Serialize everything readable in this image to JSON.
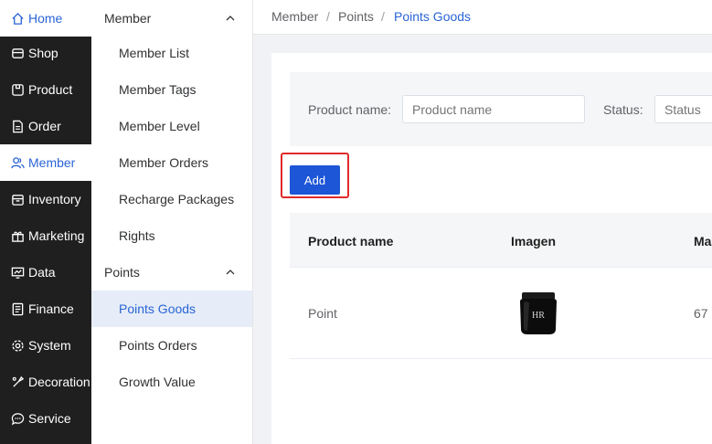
{
  "nav": {
    "items": [
      {
        "label": "Home",
        "icon": "home-icon"
      },
      {
        "label": "Shop",
        "icon": "shop-icon"
      },
      {
        "label": "Product",
        "icon": "product-icon"
      },
      {
        "label": "Order",
        "icon": "order-icon"
      },
      {
        "label": "Member",
        "icon": "member-icon"
      },
      {
        "label": "Inventory",
        "icon": "inventory-icon"
      },
      {
        "label": "Marketing",
        "icon": "gift-icon"
      },
      {
        "label": "Data",
        "icon": "chart-icon"
      },
      {
        "label": "Finance",
        "icon": "finance-icon"
      },
      {
        "label": "System",
        "icon": "gear-icon"
      },
      {
        "label": "Decoration",
        "icon": "decoration-icon"
      },
      {
        "label": "Service",
        "icon": "chat-icon"
      }
    ]
  },
  "submenu": {
    "group_member": "Member",
    "member_items": [
      "Member List",
      "Member Tags",
      "Member Level",
      "Member Orders",
      "Recharge Packages",
      "Rights"
    ],
    "group_points": "Points",
    "points_items": [
      "Points Goods",
      "Points Orders",
      "Growth Value"
    ]
  },
  "breadcrumb": [
    "Member",
    "Points",
    "Points Goods"
  ],
  "breadcrumb_separator": "/",
  "filter": {
    "product_name_label": "Product name:",
    "product_name_placeholder": "Product name",
    "status_label": "Status:",
    "status_placeholder": "Status"
  },
  "add_button": "Add",
  "table": {
    "columns": [
      "Product name",
      "Imagen",
      "Ma"
    ],
    "rows": [
      {
        "product_name": "Point",
        "image_text": "HR",
        "col3": "67"
      }
    ]
  },
  "colors": {
    "accent": "#2a64d6",
    "button": "#1d56d6",
    "highlight_box": "#e02a2a",
    "nav_bg": "#1f1f1f"
  }
}
